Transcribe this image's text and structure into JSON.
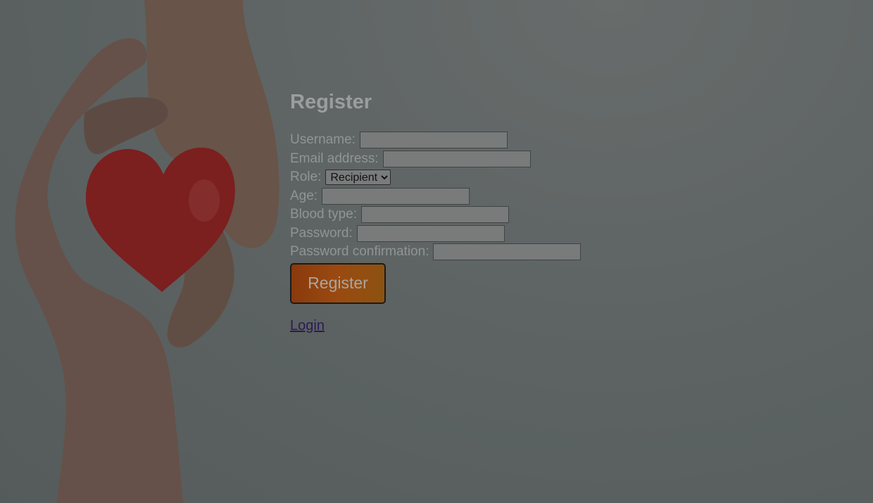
{
  "form": {
    "title": "Register",
    "fields": [
      {
        "label": "Username:",
        "value": ""
      },
      {
        "label": "Email address:",
        "value": ""
      },
      {
        "label": "Role:",
        "selected": "Recipient"
      },
      {
        "label": "Age:",
        "value": ""
      },
      {
        "label": "Blood type:",
        "value": ""
      },
      {
        "label": "Password:",
        "value": ""
      },
      {
        "label": "Password confirmation:",
        "value": ""
      }
    ],
    "submit_label": "Register",
    "login_link": "Login"
  },
  "colors": {
    "button": "#9a4a10",
    "link": "#2c1a55",
    "heart": "#b01818"
  }
}
